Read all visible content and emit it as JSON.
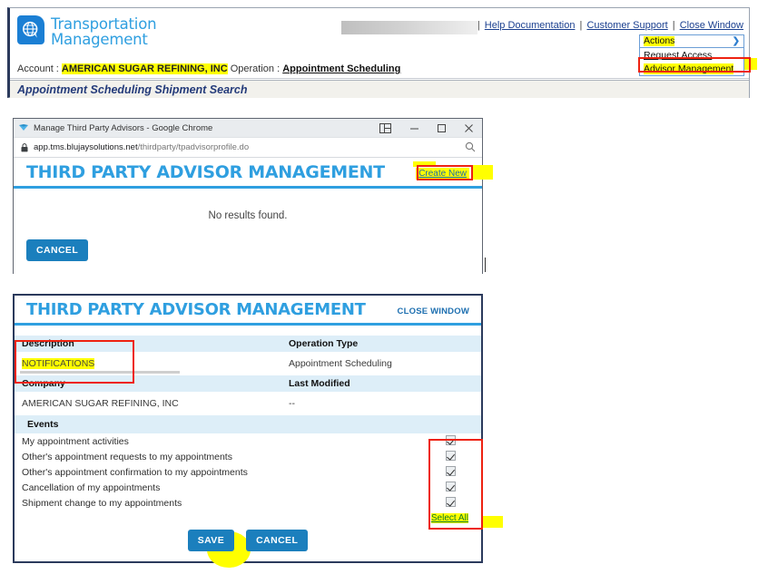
{
  "app": {
    "brand": {
      "line1": "Transportation",
      "line2": "Management",
      "logo_icon": "globe-speech-bubble-icon",
      "logo_color": "#1b7fd4",
      "text_color": "#2f9fe0"
    },
    "top_links": {
      "help": "Help Documentation",
      "support": "Customer Support",
      "close": "Close Window",
      "separator": "|"
    },
    "actions_menu": {
      "header_label": "Actions",
      "chevron_icon": "chevron-right-icon",
      "items": [
        {
          "label": "Request Access",
          "highlighted": false
        },
        {
          "label": "Advisor Management",
          "highlighted": true
        }
      ]
    },
    "account_line": {
      "account_label": "Account :",
      "account_value": "AMERICAN SUGAR REFINING, INC",
      "operation_label": "Operation :",
      "operation_value": "Appointment Scheduling"
    },
    "page_title": "Appointment Scheduling Shipment Search"
  },
  "chrome_window": {
    "favicon_icon": "blujay-favicon-icon",
    "title": "Manage Third Party Advisors - Google Chrome",
    "window_buttons": {
      "split_icon": "split-screen-icon",
      "minimize_icon": "minimize-icon",
      "maximize_icon": "maximize-icon",
      "close_icon": "close-icon"
    },
    "omnibox": {
      "lock_icon": "lock-icon",
      "url_host": "app.tms.blujaysolutions.net",
      "url_path": "/thirdparty/tpadvisorprofile.do",
      "zoom_icon": "zoom-search-icon"
    },
    "page": {
      "title": "THIRD PARTY ADVISOR MANAGEMENT",
      "create_new_label": "Create New",
      "no_results_text": "No results found.",
      "cancel_label": "CANCEL"
    }
  },
  "form_panel": {
    "title": "THIRD PARTY ADVISOR MANAGEMENT",
    "close_window_label": "CLOSE WINDOW",
    "fields": {
      "description_header": "Description",
      "description_value": "NOTIFICATIONS",
      "operation_type_header": "Operation Type",
      "operation_type_value": "Appointment Scheduling",
      "company_header": "Company",
      "company_value": "AMERICAN SUGAR REFINING, INC",
      "last_modified_header": "Last Modified",
      "last_modified_value": "--"
    },
    "events_header": "Events",
    "events": [
      {
        "label": "My appointment activities",
        "checked": true
      },
      {
        "label": "Other's appointment requests to my appointments",
        "checked": true
      },
      {
        "label": "Other's appointment confirmation to my appointments",
        "checked": true
      },
      {
        "label": "Cancellation of my appointments",
        "checked": true
      },
      {
        "label": "Shipment change to my appointments",
        "checked": true
      }
    ],
    "select_all_label": "Select All",
    "save_label": "SAVE",
    "cancel_label": "CANCEL"
  },
  "colors": {
    "brand_blue": "#2f9fe0",
    "button_blue": "#1b7fbd",
    "header_row_blue": "#ddeef8",
    "annotation_red": "#ee2211",
    "highlight_yellow": "#ffff00",
    "link_blue": "#1a3f8f",
    "select_all_green": "#0e7a2a"
  }
}
